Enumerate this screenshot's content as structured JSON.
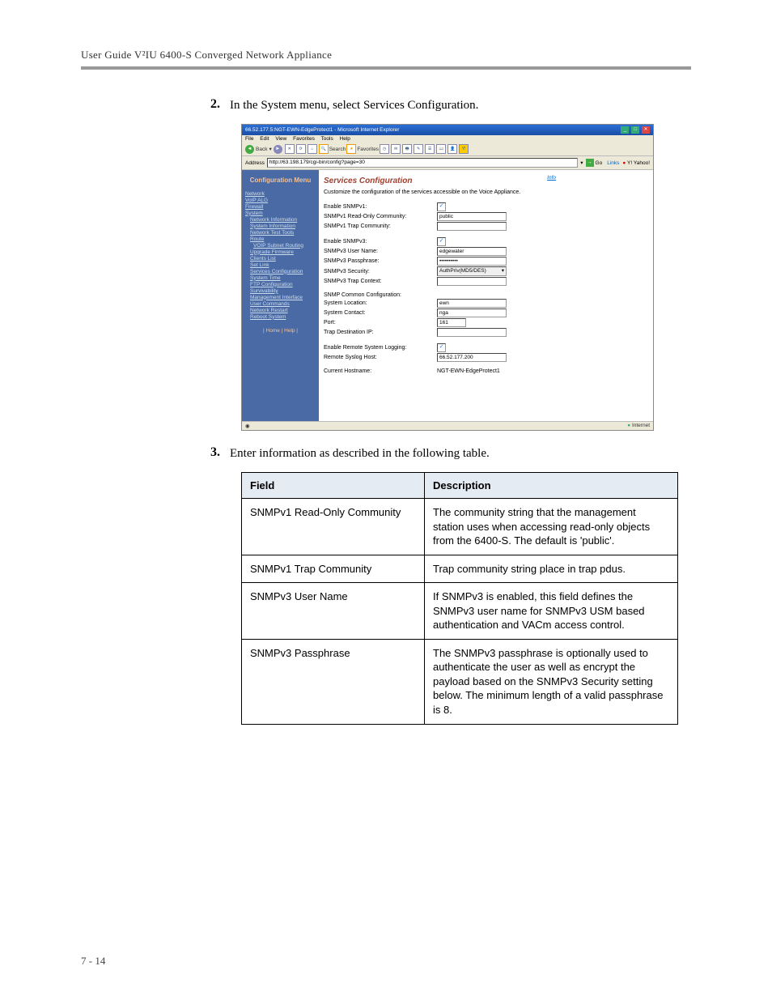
{
  "header": {
    "title": "User Guide V²IU 6400-S Converged Network Appliance"
  },
  "steps": {
    "s2": {
      "num": "2.",
      "text": "In the System menu, select Services Configuration."
    },
    "s3": {
      "num": "3.",
      "text": "Enter information as described in the following table."
    }
  },
  "screenshot": {
    "window_title": "66.52.177.5:NGT-EWN-EdgeProtect1 - Microsoft Internet Explorer",
    "menu": {
      "file": "File",
      "edit": "Edit",
      "view": "View",
      "favorites": "Favorites",
      "tools": "Tools",
      "help": "Help"
    },
    "toolbar": {
      "back": "Back",
      "search": "Search",
      "favorites": "Favorites"
    },
    "address": {
      "label": "Address",
      "value": "http://63.198.179/cgi-bin/config?page=30",
      "go": "Go",
      "links": "Links",
      "yahoo": "Y! Yahoo!"
    },
    "sidebar": {
      "title": "Configuration Menu",
      "items": {
        "network": "Network",
        "voipalg": "VoIP ALG",
        "firewall": "Firewall",
        "system": "System",
        "netinfo": "Network Information",
        "sysinfo": "System Information",
        "nettest": "Network Test Tools",
        "route": "Route",
        "voipsubnet": "VOIP Subnet Routing",
        "upgrade": "Upgrade Firmware",
        "clients": "Clients List",
        "setlink": "Set Link",
        "services": "Services Configuration",
        "systime": "System Time",
        "ftpconfig": "FTP Configuration",
        "survivability": "Survivability",
        "mgmtint": "Management Interface",
        "usercmd": "User Commands",
        "netrestart": "Network Restart",
        "reboot": "Reboot System"
      },
      "bottom": "| Home | Help |"
    },
    "content": {
      "title": "Services Configuration",
      "info": "Info",
      "desc": "Customize the configuration of the services accessible on the Voice Appliance.",
      "labels": {
        "enable_v1": "Enable SNMPv1:",
        "v1_ro": "SNMPv1 Read-Only Community:",
        "v1_trap": "SNMPv1 Trap Community:",
        "enable_v3": "Enable SNMPv3:",
        "v3_user": "SNMPv3 User Name:",
        "v3_pass": "SNMPv3 Passphrase:",
        "v3_sec": "SNMPv3 Security:",
        "v3_trap": "SNMPv3 Trap Context:",
        "common": "SNMP Common Configuration:",
        "loc": "System Location:",
        "contact": "System Contact:",
        "port": "Port:",
        "trapip": "Trap Destination IP:",
        "remote": "Enable Remote System Logging:",
        "syslog": "Remote Syslog Host:",
        "hostname": "Current Hostname:"
      },
      "values": {
        "v1_ro": "public",
        "v3_user": "edgewater",
        "v3_pass": "••••••••••",
        "v3_sec": "AuthPriv(MD5/DES)",
        "loc": "ewn",
        "contact": "nga",
        "port": "161",
        "syslog": "66.52.177.200",
        "hostname": "NGT-EWN-EdgeProtect1"
      },
      "check": "✓"
    },
    "status": {
      "left": "",
      "internet": "Internet"
    }
  },
  "table": {
    "head": {
      "field": "Field",
      "desc": "Description"
    },
    "rows": {
      "r1": {
        "field": "SNMPv1 Read-Only Community",
        "desc": "The community string that the management station uses when accessing read-only objects from the 6400-S. The default is 'public'."
      },
      "r2": {
        "field": "SNMPv1 Trap Community",
        "desc": "Trap community string place in trap pdus."
      },
      "r3": {
        "field": "SNMPv3 User Name",
        "desc": "If SNMPv3 is enabled, this field defines the SNMPv3 user name for SNMPv3 USM based authentication and VACm access control."
      },
      "r4": {
        "field": "SNMPv3 Passphrase",
        "desc": "The SNMPv3 passphrase is optionally used to authenticate the user as well as encrypt the payload based on the SNMPv3 Security setting below. The minimum length of a valid passphrase is 8."
      }
    }
  },
  "footer": "7 - 14"
}
